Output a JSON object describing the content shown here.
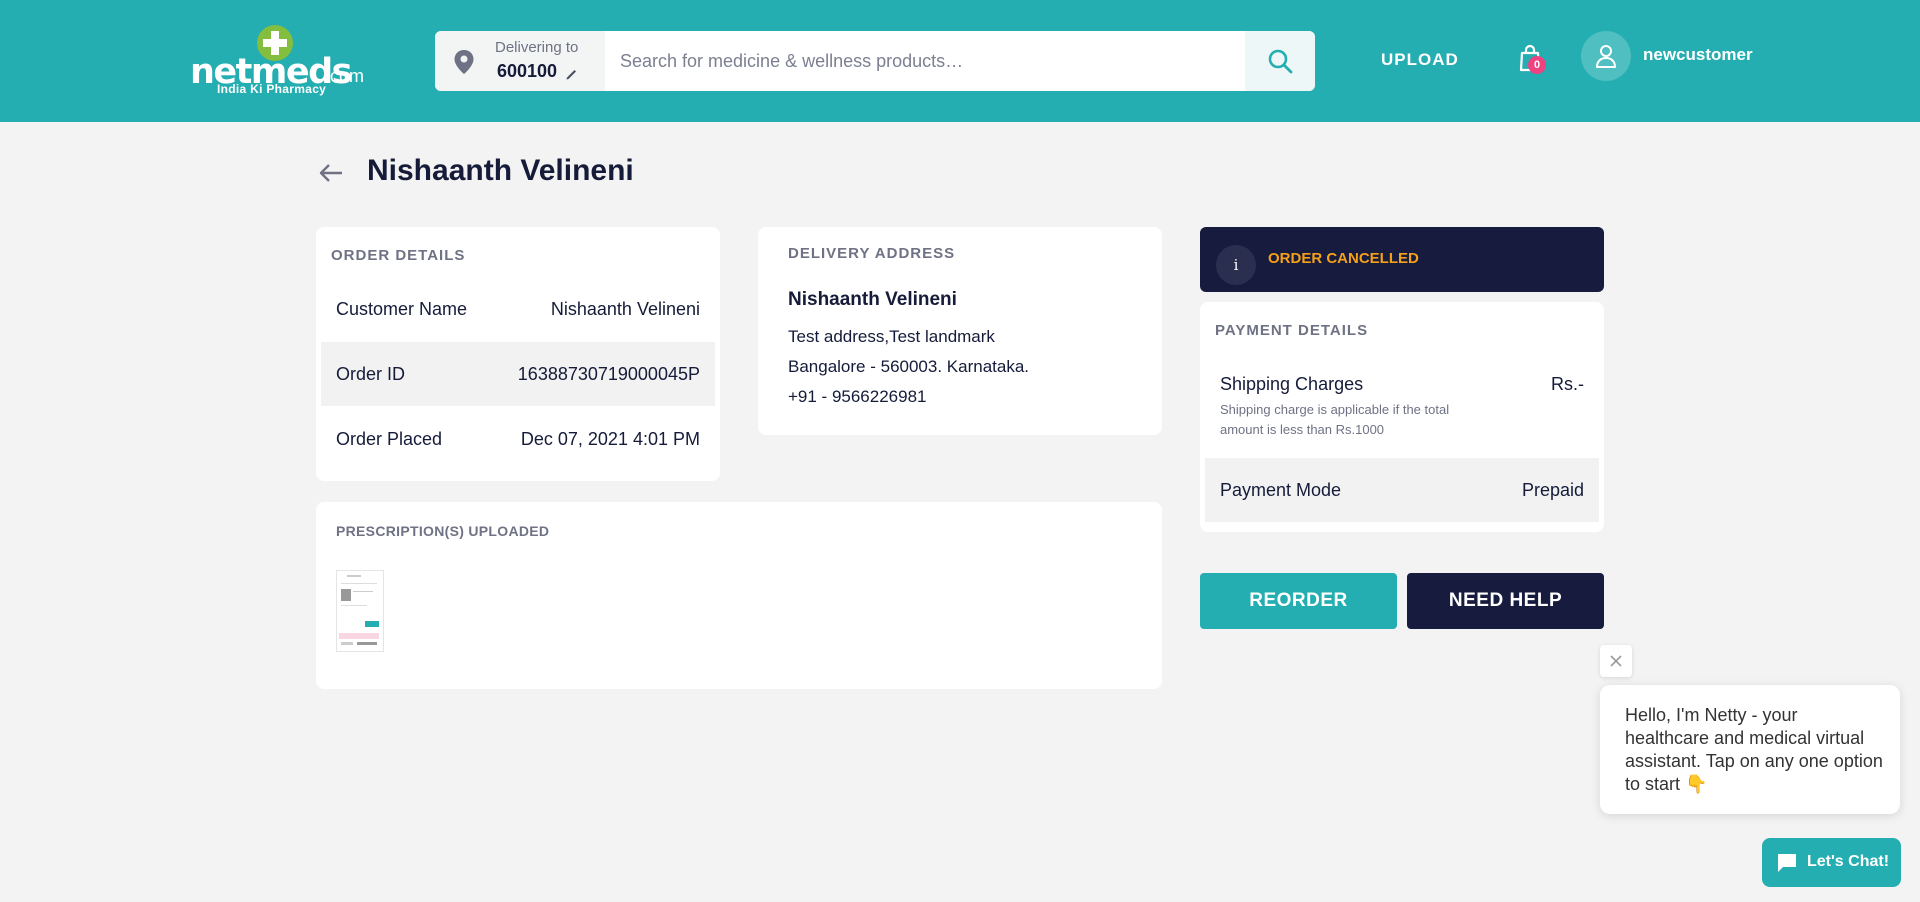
{
  "header": {
    "logo_word": "netmeds",
    "logo_suffix": ".com",
    "logo_tagline": "India Ki Pharmacy",
    "delivering_label": "Delivering to",
    "pincode": "600100",
    "search_placeholder": "Search for medicine & wellness products…",
    "upload_label": "UPLOAD",
    "cart_count": "0",
    "username": "newcustomer"
  },
  "page": {
    "title": "Nishaanth Velineni"
  },
  "order_details": {
    "title": "ORDER DETAILS",
    "rows": [
      {
        "label": "Customer Name",
        "value": "Nishaanth Velineni"
      },
      {
        "label": "Order ID",
        "value": "16388730719000045P"
      },
      {
        "label": "Order Placed",
        "value": "Dec 07, 2021 4:01 PM"
      }
    ]
  },
  "delivery_address": {
    "title": "DELIVERY ADDRESS",
    "name": "Nishaanth Velineni",
    "line1": "Test address,Test landmark",
    "line2": "Bangalore - 560003. Karnataka.",
    "phone": "+91 - 9566226981"
  },
  "prescriptions": {
    "title": "PRESCRIPTION(S) UPLOADED"
  },
  "status": {
    "icon": "info-icon",
    "text": "ORDER CANCELLED",
    "color": "#f4a01a"
  },
  "payment_details": {
    "title": "PAYMENT DETAILS",
    "shipping_label": "Shipping Charges",
    "shipping_note": "Shipping charge is applicable if the total amount is less than Rs.1000",
    "shipping_value": "Rs.-",
    "mode_label": "Payment Mode",
    "mode_value": "Prepaid"
  },
  "actions": {
    "reorder": "REORDER",
    "need_help": "NEED HELP"
  },
  "chat": {
    "message": "Hello, I'm Netty - your healthcare and medical virtual assistant. Tap on any one option to start 👇",
    "button": "Let's Chat!"
  },
  "colors": {
    "brand": "#24aeb1",
    "dark": "#171b3d",
    "badge": "#ef4281",
    "warning": "#f4a01a"
  }
}
